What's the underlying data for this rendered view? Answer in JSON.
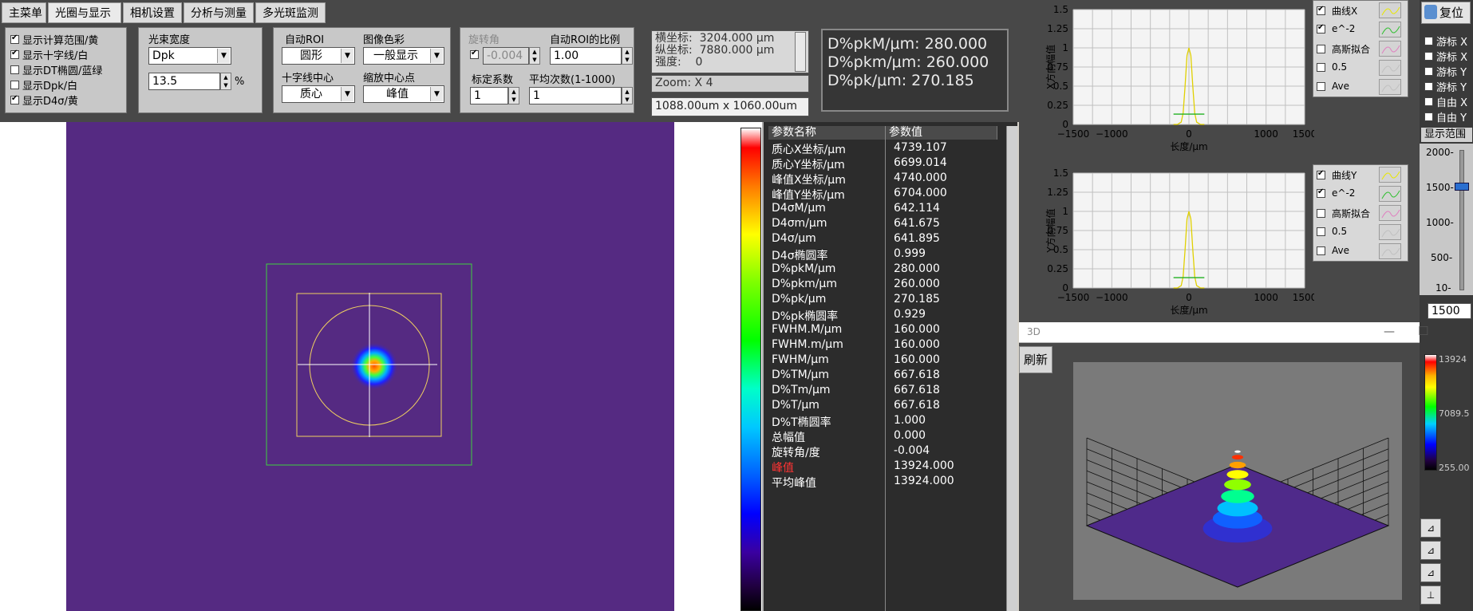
{
  "tabs": [
    "主菜单",
    "光圈与显示",
    "相机设置",
    "分析与测量",
    "多光斑监测"
  ],
  "display_options": [
    {
      "label": "显示计算范围/黄",
      "checked": true
    },
    {
      "label": "显示十字线/白",
      "checked": true
    },
    {
      "label": "显示DT椭圆/蓝绿",
      "checked": false
    },
    {
      "label": "显示Dpk/白",
      "checked": false
    },
    {
      "label": "显示D4σ/黄",
      "checked": true
    }
  ],
  "beam_width": {
    "label": "光束宽度",
    "mode": "Dpk",
    "value": "13.5",
    "unit": "%"
  },
  "roi": {
    "auto_roi_label": "自动ROI",
    "auto_roi_value": "圆形",
    "color_label": "图像色彩",
    "color_value": "一般显示",
    "crosshair_label": "十字线中心",
    "crosshair_value": "质心",
    "zoom_center_label": "缩放中心点",
    "zoom_center_value": "峰值"
  },
  "rotation": {
    "label": "旋转角",
    "checked": true,
    "value": "-0.004",
    "ratio_label": "自动ROI的比例",
    "ratio_value": "1.00",
    "cal_label": "标定系数",
    "cal_value": "1",
    "avg_label": "平均次数(1-1000)",
    "avg_value": "1"
  },
  "coords": {
    "text": "横坐标:  3204.000 μm\n纵坐标:  7880.000 μm\n强度:    0",
    "zoom": "Zoom: X 4",
    "size": "1088.00um x 1060.00um"
  },
  "big_results": [
    "D%pkM/μm: 280.000",
    "D%pkm/μm: 260.000",
    "D%pk/μm: 270.185"
  ],
  "table": {
    "headers": [
      "参数名称",
      "参数值"
    ],
    "rows": [
      [
        "质心X坐标/μm",
        "4739.107"
      ],
      [
        "质心Y坐标/μm",
        "6699.014"
      ],
      [
        "峰值X坐标/μm",
        "4740.000"
      ],
      [
        "峰值Y坐标/μm",
        "6704.000"
      ],
      [
        "D4σM/μm",
        "642.114"
      ],
      [
        "D4σm/μm",
        "641.675"
      ],
      [
        "D4σ/μm",
        "641.895"
      ],
      [
        "D4σ椭圆率",
        "0.999"
      ],
      [
        "D%pkM/μm",
        "280.000"
      ],
      [
        "D%pkm/μm",
        "260.000"
      ],
      [
        "D%pk/μm",
        "270.185"
      ],
      [
        "D%pk椭圆率",
        "0.929"
      ],
      [
        "FWHM.M/μm",
        "160.000"
      ],
      [
        "FWHM.m/μm",
        "160.000"
      ],
      [
        "FWHM/μm",
        "160.000"
      ],
      [
        "D%TM/μm",
        "667.618"
      ],
      [
        "D%Tm/μm",
        "667.618"
      ],
      [
        "D%T/μm",
        "667.618"
      ],
      [
        "D%T椭圆率",
        "1.000"
      ],
      [
        "总幅值",
        "0.000"
      ],
      [
        "旋转角/度",
        "-0.004"
      ],
      [
        "峰值",
        "13924.000"
      ],
      [
        "平均峰值",
        "13924.000"
      ]
    ],
    "highlight_color": "#ff3333"
  },
  "chart_x": {
    "ylabel": "X方向幅值",
    "xlabel": "长度/μm",
    "yticks": [
      "1.5",
      "1.25",
      "1",
      "0.75",
      "0.5",
      "0.25",
      "0"
    ],
    "xticks": [
      "-1500",
      "-1000",
      "0",
      "1000",
      "1500"
    ],
    "legend": [
      {
        "label": "曲线X",
        "checked": true
      },
      {
        "label": "e^-2",
        "checked": true
      },
      {
        "label": "高斯拟合",
        "checked": false
      },
      {
        "label": "0.5",
        "checked": false
      },
      {
        "label": "Ave",
        "checked": false
      }
    ]
  },
  "chart_y": {
    "ylabel": "Y方向幅值",
    "xlabel": "长度/μm",
    "yticks": [
      "1.5",
      "1.25",
      "1",
      "0.75",
      "0.5",
      "0.25",
      "0"
    ],
    "xticks": [
      "-1500",
      "-1000",
      "0",
      "1000",
      "1500"
    ],
    "legend": [
      {
        "label": "曲线Y",
        "checked": true
      },
      {
        "label": "e^-2",
        "checked": true
      },
      {
        "label": "高斯拟合",
        "checked": false
      },
      {
        "label": "0.5",
        "checked": false
      },
      {
        "label": "Ave",
        "checked": false
      }
    ]
  },
  "right": {
    "reset": "复位",
    "cursors": [
      "游标 X",
      "游标 X",
      "游标 Y",
      "游标 Y",
      "自由 X",
      "自由 Y"
    ],
    "range_label": "显示范围",
    "scale": [
      "2000-",
      "1500-",
      "1000-",
      "500-",
      "10-"
    ],
    "range_value": "1500"
  },
  "win3d": {
    "title": "3D",
    "refresh": "刷新",
    "colorbar": [
      "13924",
      "7089.5",
      "255.00"
    ]
  },
  "chart_data": [
    {
      "type": "line",
      "title": "",
      "xlabel": "长度/μm",
      "ylabel": "X方向幅值",
      "xlim": [
        -1500,
        1500
      ],
      "ylim": [
        0,
        1.5
      ],
      "series": [
        {
          "name": "曲线X",
          "x": [
            -200,
            -150,
            -100,
            -75,
            -50,
            -25,
            0,
            25,
            50,
            75,
            100,
            150,
            200
          ],
          "y": [
            0,
            0,
            0.03,
            0.15,
            0.5,
            0.9,
            1.0,
            0.9,
            0.5,
            0.15,
            0.03,
            0,
            0
          ]
        },
        {
          "name": "e^-2",
          "x": [
            -200,
            200
          ],
          "y": [
            0.135,
            0.135
          ]
        }
      ]
    },
    {
      "type": "line",
      "title": "",
      "xlabel": "长度/μm",
      "ylabel": "Y方向幅值",
      "xlim": [
        -1500,
        1500
      ],
      "ylim": [
        0,
        1.5
      ],
      "series": [
        {
          "name": "曲线Y",
          "x": [
            -200,
            -150,
            -100,
            -75,
            -50,
            -25,
            0,
            25,
            50,
            75,
            100,
            150,
            200
          ],
          "y": [
            0,
            0,
            0.03,
            0.15,
            0.5,
            0.9,
            1.0,
            0.9,
            0.5,
            0.15,
            0.03,
            0,
            0
          ]
        },
        {
          "name": "e^-2",
          "x": [
            -200,
            200
          ],
          "y": [
            0.135,
            0.135
          ]
        }
      ]
    }
  ]
}
